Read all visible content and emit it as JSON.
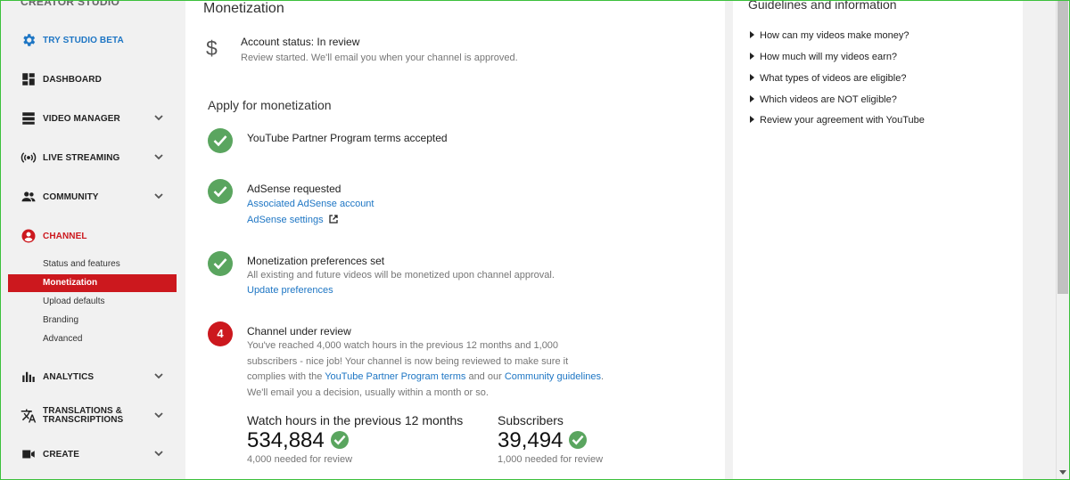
{
  "app": {
    "brand": "CREATOR STUDIO"
  },
  "sidebar": {
    "nav": [
      {
        "label": "TRY STUDIO BETA",
        "icon": "gear-icon"
      },
      {
        "label": "DASHBOARD",
        "icon": "dashboard-icon"
      },
      {
        "label": "VIDEO MANAGER",
        "icon": "video-manager-icon"
      },
      {
        "label": "LIVE STREAMING",
        "icon": "live-streaming-icon"
      },
      {
        "label": "COMMUNITY",
        "icon": "community-icon"
      },
      {
        "label": "CHANNEL",
        "icon": "channel-icon"
      },
      {
        "label": "ANALYTICS",
        "icon": "analytics-icon"
      },
      {
        "label_line1": "TRANSLATIONS &",
        "label_line2": "TRANSCRIPTIONS",
        "icon": "translate-icon"
      },
      {
        "label": "CREATE",
        "icon": "create-video-icon"
      }
    ],
    "channel_sub": [
      "Status and features",
      "Monetization",
      "Upload defaults",
      "Branding",
      "Advanced"
    ],
    "active_sub": "Monetization"
  },
  "main": {
    "title": "Monetization",
    "account": {
      "status": "Account status: In review",
      "note": "Review started. We'll email you when your channel is approved."
    },
    "apply_heading": "Apply for monetization",
    "steps": [
      {
        "title": "YouTube Partner Program terms accepted",
        "state": "done"
      },
      {
        "title": "AdSense requested",
        "state": "done",
        "links": [
          "Associated AdSense account",
          "AdSense settings"
        ]
      },
      {
        "title": "Monetization preferences set",
        "state": "done",
        "desc": "All existing and future videos will be monetized upon channel approval.",
        "links": [
          "Update preferences"
        ]
      },
      {
        "title": "Channel under review",
        "state": "current",
        "number": "4",
        "desc_lines": [
          "You've reached 4,000 watch hours in the previous 12 months and 1,000",
          "subscribers - nice job! Your channel is now being reviewed to make sure it"
        ],
        "desc_line3_pre": "complies with the ",
        "desc_link1": "YouTube Partner Program terms",
        "desc_line3_mid": " and our ",
        "desc_link2": "Community guidelines",
        "desc_line3_end": ".",
        "desc_line4": "We'll email you a decision, usually within a month or so."
      }
    ],
    "metrics": [
      {
        "label": "Watch hours in the previous 12 months",
        "value": "534,884",
        "note": "4,000 needed for review"
      },
      {
        "label": "Subscribers",
        "value": "39,494",
        "note": "1,000 needed for review"
      }
    ]
  },
  "guidelines": {
    "title": "Guidelines and information",
    "items": [
      "How can my videos make money?",
      "How much will my videos earn?",
      "What types of videos are eligible?",
      "Which videos are NOT eligible?",
      "Review your agreement with YouTube"
    ]
  },
  "colors": {
    "accent_blue": "#1e76c4",
    "accent_red": "#cc181e",
    "success_green": "#5aa55f"
  }
}
